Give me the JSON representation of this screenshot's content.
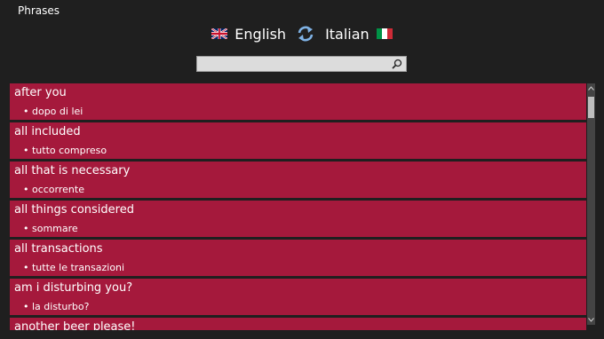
{
  "app": {
    "title": "Phrases"
  },
  "languages": {
    "source": "English",
    "target": "Italian",
    "source_flag_icon": "uk-flag-icon",
    "target_flag_icon": "italy-flag-icon",
    "swap_icon": "swap-arrows-icon"
  },
  "search": {
    "value": "",
    "placeholder": "",
    "icon": "search-icon"
  },
  "colors": {
    "background": "#1f1f1f",
    "row": "#a5193c",
    "text": "#ffffff"
  },
  "phrases": [
    {
      "english": "after you",
      "italian": "• dopo di lei"
    },
    {
      "english": "all included",
      "italian": "• tutto compreso"
    },
    {
      "english": "all that is necessary",
      "italian": "• occorrente"
    },
    {
      "english": "all things considered",
      "italian": "• sommare"
    },
    {
      "english": "all transactions",
      "italian": "• tutte le transazioni"
    },
    {
      "english": "am i disturbing you?",
      "italian": "• la disturbo?"
    },
    {
      "english": "another beer please!",
      "italian": ""
    }
  ]
}
